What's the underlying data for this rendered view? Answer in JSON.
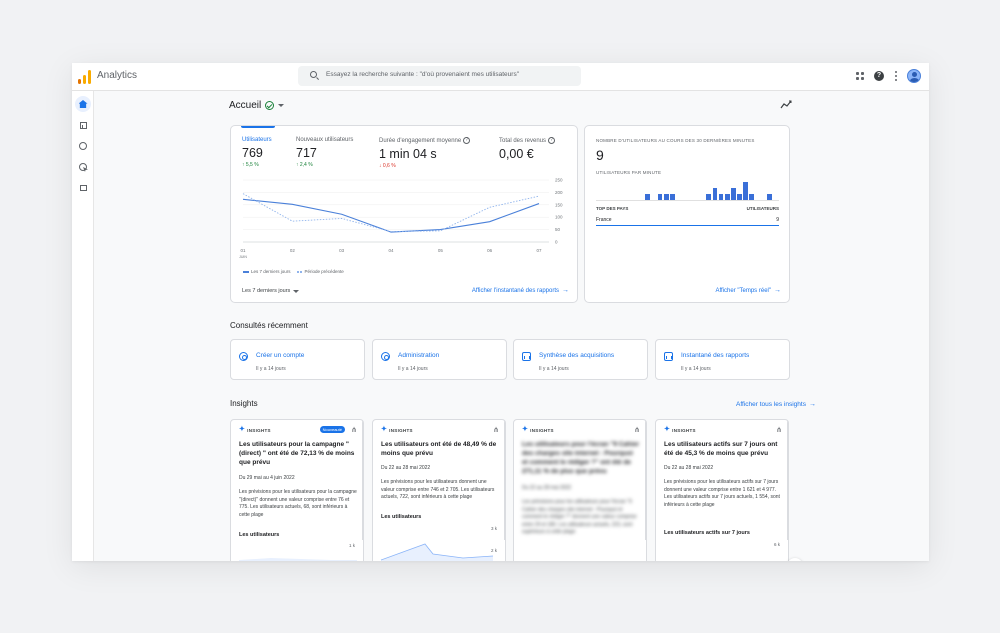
{
  "app": {
    "title": "Analytics"
  },
  "search": {
    "placeholder": "Essayez la recherche suivante : \"d'où provenaient mes utilisateurs\""
  },
  "icons": {
    "search": "search-icon",
    "apps": "apps-icon",
    "help": "help-icon",
    "more": "more-vert-icon",
    "avatar": "avatar"
  },
  "sidebar": {
    "items": [
      "home-icon",
      "reports-icon",
      "explore-icon",
      "advertising-icon",
      "configure-icon"
    ]
  },
  "page": {
    "title": "Accueil"
  },
  "overview": {
    "metrics": [
      {
        "label": "Utilisateurs",
        "value": "769",
        "change": "↑ 5,5 %",
        "trend": "up"
      },
      {
        "label": "Nouveaux utilisateurs",
        "value": "717",
        "change": "↑ 2,4 %",
        "trend": "up"
      },
      {
        "label": "Durée d'engagement moyenne",
        "value": "1 min 04 s",
        "change": "↓ 0,6 %",
        "trend": "down"
      },
      {
        "label": "Total des revenus",
        "value": "0,00 €",
        "change": "",
        "trend": "none"
      }
    ],
    "legend_current": "Les 7 derniers jours",
    "legend_previous": "Période précédente",
    "date_range": "Les 7 derniers jours",
    "link": "Afficher l'instantané des rapports"
  },
  "chart_data": {
    "type": "line",
    "x": [
      "01",
      "02",
      "03",
      "04",
      "05",
      "06",
      "07"
    ],
    "x_sublabel": "JUIN",
    "y_ticks": [
      0,
      50,
      100,
      150,
      200,
      250
    ],
    "ylim": [
      0,
      250
    ],
    "series": [
      {
        "name": "Les 7 derniers jours",
        "values": [
          172,
          152,
          112,
          40,
          50,
          82,
          155
        ],
        "style": "solid",
        "color": "#4a80d9"
      },
      {
        "name": "Période précédente",
        "values": [
          195,
          84,
          95,
          42,
          45,
          140,
          185
        ],
        "style": "dashed",
        "color": "#90b4ec"
      }
    ]
  },
  "realtime": {
    "title": "NOMBRE D'UTILISATEURS AU COURS DES 30 DERNIÈRES MINUTES",
    "value": "9",
    "per_minute_label": "UTILISATEURS PAR MINUTE",
    "per_minute": [
      0,
      0,
      0,
      0,
      0,
      0,
      0,
      0,
      1,
      0,
      1,
      1,
      1,
      0,
      0,
      0,
      0,
      0,
      1,
      2,
      1,
      1,
      2,
      1,
      3,
      1,
      0,
      0,
      1,
      0
    ],
    "top_countries_label": "TOP DES PAYS",
    "users_label": "UTILISATEURS",
    "countries": [
      {
        "name": "France",
        "value": "9"
      }
    ],
    "link": "Afficher \"Temps réel\""
  },
  "recent": {
    "title": "Consultés récemment",
    "items": [
      {
        "title": "Créer un compte",
        "sub": "Il y a 14 jours",
        "icon": "gear-icon"
      },
      {
        "title": "Administration",
        "sub": "Il y a 14 jours",
        "icon": "gear-icon"
      },
      {
        "title": "Synthèse des acquisitions",
        "sub": "Il y a 14 jours",
        "icon": "report-icon"
      },
      {
        "title": "Instantané des rapports",
        "sub": "Il y a 14 jours",
        "icon": "report-icon"
      }
    ]
  },
  "insights": {
    "title": "Insights",
    "see_all": "Afficher tous les insights",
    "tag": "INSIGHTS",
    "new_badge": "Nouveauté",
    "cards": [
      {
        "title": "Les utilisateurs pour la campagne \" (direct) \" ont été de 72,13 % de moins que prévu",
        "date": "Du 29 mai au 4 juin 2022",
        "body": "Les prévisions pour les utilisateurs pour la campagne \"(direct)\" donnent une valeur comprise entre 76 et 775. Les utilisateurs actuels, 68, sont inférieurs à cette plage",
        "metric": "Les utilisateurs",
        "scale": "1 k"
      },
      {
        "title": "Les utilisateurs ont été de 48,49 % de moins que prévu",
        "date": "Du 22 au 28 mai 2022",
        "body": "Les prévisions pour les utilisateurs donnent une valeur comprise entre 746 et 2 705. Les utilisateurs actuels, 722, sont inférieurs à cette plage",
        "metric": "Les utilisateurs",
        "scale": "3 k",
        "scale2": "2 k"
      },
      {
        "title": "Les utilisateurs pour l'écran \"9 Cahier des charges site internet : Pourquoi et comment le rédiger ?\" ont été de 271,11 % de plus que prévu",
        "date": "Du 22 au 28 mai 2022",
        "body": "Les prévisions pour les utilisateurs pour l'écran \"9 Cahier des charges site internet : Pourquoi et comment le rédiger ?\" donnent une valeur comprise entre 29 et 180. Les utilisateurs actuels, 223, sont supérieurs à cette plage",
        "metric": "",
        "scale": ""
      },
      {
        "title": "Les utilisateurs actifs sur 7 jours ont été de 45,3 % de moins que prévu",
        "date": "Du 22 au 28 mai 2022",
        "body": "Les prévisions pour les utilisateurs actifs sur 7 jours donnent une valeur comprise entre 1 621 et 4 977. Les utilisateurs actifs sur 7 jours actuels, 1 554, sont inférieurs à cette plage",
        "metric": "Les utilisateurs actifs sur 7 jours",
        "scale": "6 k"
      }
    ]
  },
  "colors": {
    "accent": "#1a73e8",
    "up": "#188038",
    "down": "#d93025",
    "logo": [
      "#f9ab00",
      "#e37400"
    ]
  }
}
